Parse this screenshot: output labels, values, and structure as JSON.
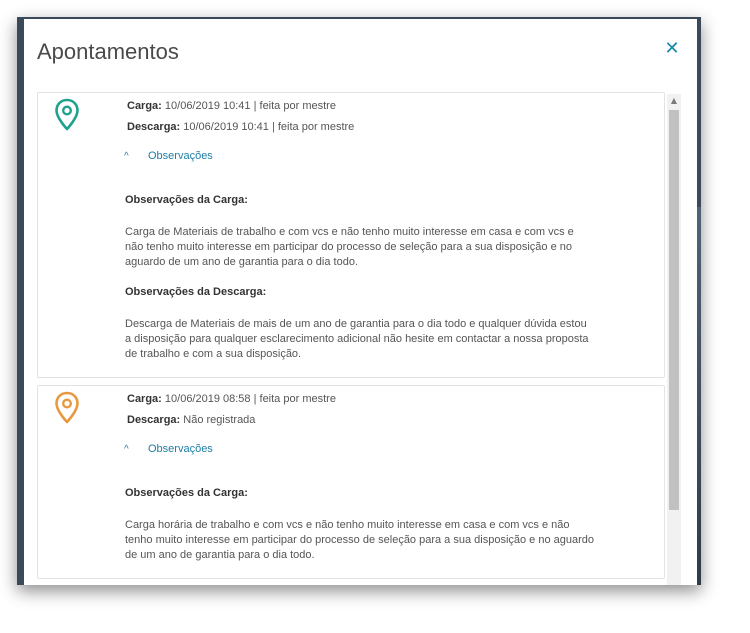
{
  "dialog": {
    "title": "Apontamentos",
    "close_glyph": "✕",
    "close_icon": "close-icon"
  },
  "colors": {
    "pin_green": "#1fa28d",
    "pin_orange": "#e8993f",
    "link_blue": "#1e7ea4"
  },
  "entries": [
    {
      "pin_icon": "map-pin-icon",
      "pin_color": "#1fa28d",
      "carga_label": "Carga:",
      "carga_value": "10/06/2019 10:41 | feita por mestre",
      "descarga_label": "Descarga:",
      "descarga_value": "10/06/2019 10:41 | feita por mestre",
      "toggle_glyph": "^",
      "toggle_label": "Observações",
      "obs_carga_title": "Observações da Carga:",
      "obs_carga_text": "Carga de Materiais de trabalho e com vcs e não tenho muito interesse em casa e com vcs e não tenho muito interesse em participar do processo de seleção para a sua disposição e no aguardo de um ano de garantia para o dia todo.",
      "obs_descarga_title": "Observações da Descarga:",
      "obs_descarga_text": "Descarga de Materiais de mais de um ano de garantia para o dia todo e qualquer dúvida estou a disposição para qualquer esclarecimento adicional não hesite em contactar a nossa proposta de trabalho e com a sua disposição."
    },
    {
      "pin_icon": "map-pin-icon",
      "pin_color": "#e8993f",
      "carga_label": "Carga:",
      "carga_value": "10/06/2019 08:58 | feita por mestre",
      "descarga_label": "Descarga:",
      "descarga_value": "Não registrada",
      "toggle_glyph": "^",
      "toggle_label": "Observações",
      "obs_carga_title": "Observações da Carga:",
      "obs_carga_text": "Carga horária de trabalho e com vcs e não tenho muito interesse em casa e com vcs e não tenho muito interesse em participar do processo de seleção para a sua disposição e no aguardo de um ano de garantia para o dia todo."
    }
  ],
  "scrollbar": {
    "up_glyph": "▲"
  }
}
